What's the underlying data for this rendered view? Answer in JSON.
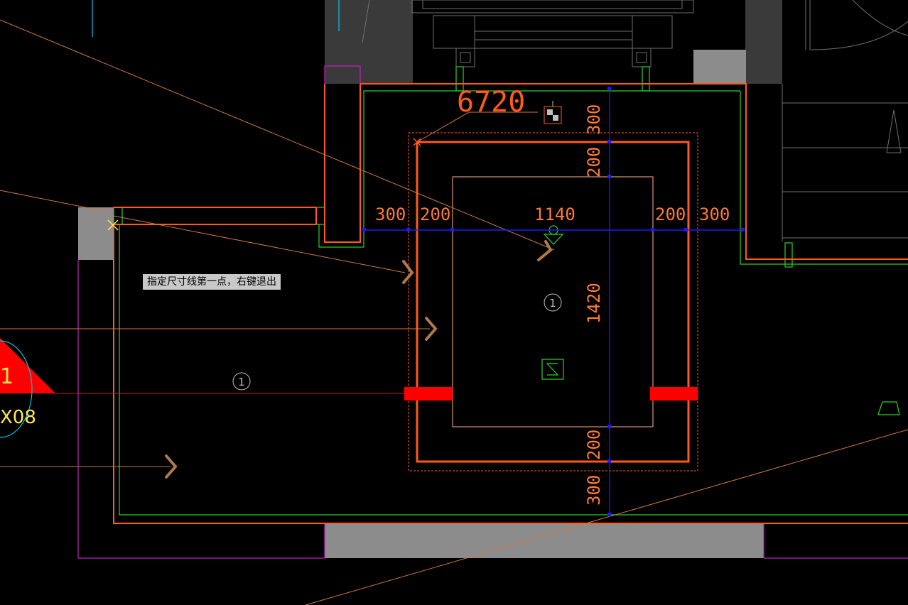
{
  "prompt": {
    "text": "指定尺寸线第一点，右键退出"
  },
  "dimensions": {
    "overall_width": "6720",
    "top_gap": "300",
    "top_inner": "200",
    "bottom_inner": "200",
    "bottom_gap": "300",
    "left_gap": "300",
    "left_inner": "200",
    "pit_width": "1140",
    "right_inner": "200",
    "right_gap": "300",
    "pit_depth": "1420"
  },
  "markers": {
    "pit_number": "1",
    "axis_number": "1",
    "partial_label_a": "1",
    "partial_label_b": "X08"
  },
  "colors": {
    "background": "#000000",
    "wall_fill": "#3a3a3a",
    "column_fill": "#8c8c8c",
    "boundary_orange": "#ff5a1a",
    "green_outline": "#27d427",
    "magenta_outline": "#c020c0",
    "dimension_blue": "#1010ff",
    "red_block": "#ff0000",
    "cursor_yellow": "#ffe94a"
  }
}
